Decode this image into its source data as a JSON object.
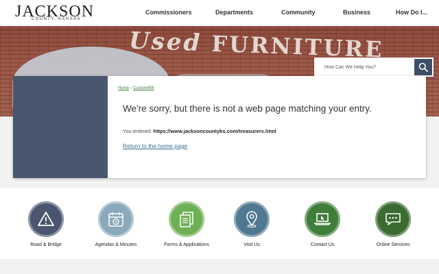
{
  "logo": {
    "name": "JACKSON",
    "subtitle": "COUNTY, KANSAS"
  },
  "nav": {
    "items": [
      {
        "label": "Commissioners"
      },
      {
        "label": "Departments"
      },
      {
        "label": "Community"
      },
      {
        "label": "Business"
      },
      {
        "label": "How Do I..."
      }
    ]
  },
  "banner": {
    "sign_text_1": "Used",
    "sign_text_2": "FURNITURE"
  },
  "search": {
    "placeholder": "How Can We Help You?",
    "icon": "search-icon"
  },
  "breadcrumb": {
    "home": "Home",
    "separator": "›",
    "current": "Custom404"
  },
  "error": {
    "heading": "We're sorry, but there is not a web page matching your entry.",
    "entered_label": "You entered:",
    "entered_url": "https://www.jacksoncountyks.com/treasurers.html",
    "return_link": "Return to the home page"
  },
  "quick_links": [
    {
      "label": "Road & Bridge",
      "icon": "warning-icon",
      "color": "#4a5670"
    },
    {
      "label": "Agendas & Minutes",
      "icon": "calendar-icon",
      "color": "#8aa9bd"
    },
    {
      "label": "Forms & Applications",
      "icon": "documents-icon",
      "color": "#6fb055"
    },
    {
      "label": "Visit Us",
      "icon": "map-pin-icon",
      "color": "#4f7891"
    },
    {
      "label": "Contact Us",
      "icon": "laptop-cursor-icon",
      "color": "#3f7d3a"
    },
    {
      "label": "Online Services",
      "icon": "chat-icon",
      "color": "#3b6b31"
    }
  ],
  "colors": {
    "card_side": "#4a5670",
    "link": "#3a6a8f",
    "breadcrumb": "#3a7a3a",
    "search_button": "#3f4f68"
  }
}
